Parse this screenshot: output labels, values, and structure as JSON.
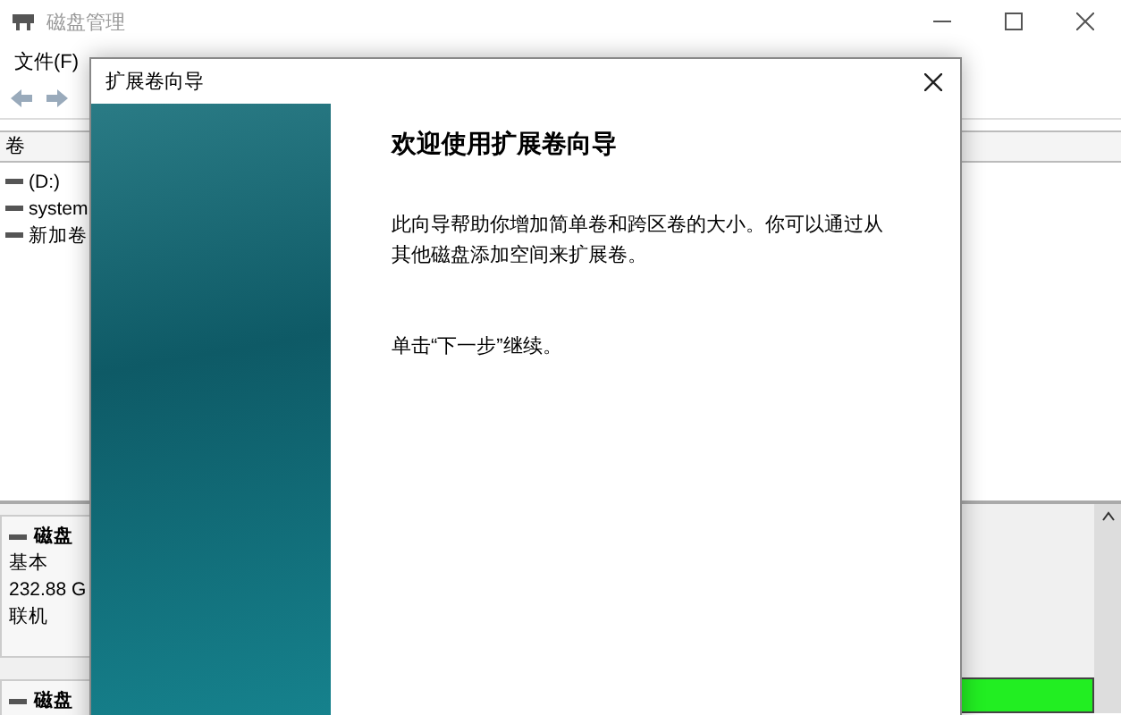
{
  "window": {
    "title": "磁盘管理"
  },
  "menu": [
    "文件(F)"
  ],
  "volume_list": {
    "columns": [
      "卷"
    ],
    "rows": [
      {
        "name": "(D:)"
      },
      {
        "name": "system"
      },
      {
        "name": "新加卷"
      }
    ]
  },
  "disks": [
    {
      "name": "磁盘",
      "lines": [
        "基本",
        "232.88 G",
        "联机"
      ]
    },
    {
      "name": "磁盘"
    }
  ],
  "dialog": {
    "title": "扩展卷向导",
    "heading": "欢迎使用扩展卷向导",
    "paragraphs": [
      "此向导帮助你增加简单卷和跨区卷的大小。你可以通过从其他磁盘添加空间来扩展卷。",
      "单击“下一步”继续。"
    ]
  }
}
